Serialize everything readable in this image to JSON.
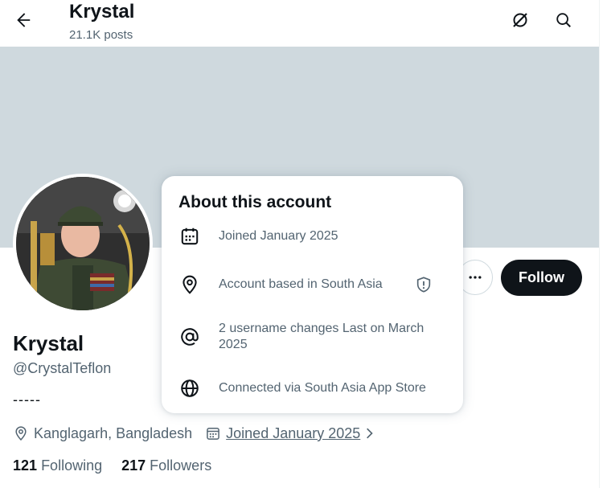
{
  "header": {
    "title": "Krystal",
    "posts_count": "21.1K posts"
  },
  "profile": {
    "display_name": "Krystal",
    "handle": "@CrystalTeflon",
    "bio": "-----",
    "location": "Kanglagarh, Bangladesh",
    "joined": "Joined January 2025",
    "following_count": "121",
    "following_label": "Following",
    "followers_count": "217",
    "followers_label": "Followers",
    "follow_label": "Follow"
  },
  "about": {
    "title": "About this account",
    "rows": [
      {
        "icon": "calendar-icon",
        "text": "Joined January 2025"
      },
      {
        "icon": "location-pin-icon",
        "text": "Account based in South Asia"
      },
      {
        "icon": "at-sign-icon",
        "text": "2 username changes Last on March 2025"
      },
      {
        "icon": "globe-icon",
        "text": "Connected via South Asia App Store"
      }
    ]
  },
  "colors": {
    "banner": "#cfd9de",
    "primary_text": "#0f1419",
    "secondary_text": "#536471",
    "follow_bg": "#0f1419"
  }
}
